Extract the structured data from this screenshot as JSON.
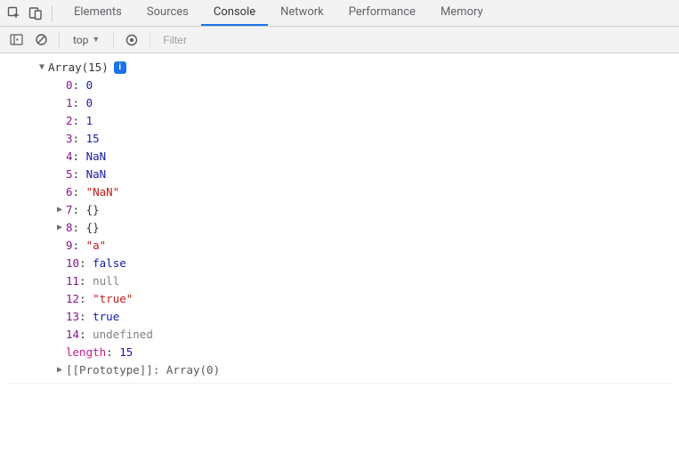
{
  "toolbar": {
    "tabs": [
      "Elements",
      "Sources",
      "Console",
      "Network",
      "Performance",
      "Memory"
    ],
    "active_tab_index": 2
  },
  "consolebar": {
    "context": "top",
    "filter_placeholder": "Filter"
  },
  "output": {
    "header": "Array(15)",
    "info": "i",
    "entries": [
      {
        "index": "0",
        "value": "0",
        "type": "num"
      },
      {
        "index": "1",
        "value": "0",
        "type": "num"
      },
      {
        "index": "2",
        "value": "1",
        "type": "num"
      },
      {
        "index": "3",
        "value": "15",
        "type": "num"
      },
      {
        "index": "4",
        "value": "NaN",
        "type": "nan"
      },
      {
        "index": "5",
        "value": "NaN",
        "type": "nan"
      },
      {
        "index": "6",
        "value": "\"NaN\"",
        "type": "str"
      },
      {
        "index": "7",
        "value": "{}",
        "type": "obj",
        "expandable": true
      },
      {
        "index": "8",
        "value": "{}",
        "type": "obj",
        "expandable": true
      },
      {
        "index": "9",
        "value": "\"a\"",
        "type": "str"
      },
      {
        "index": "10",
        "value": "false",
        "type": "bool"
      },
      {
        "index": "11",
        "value": "null",
        "type": "null"
      },
      {
        "index": "12",
        "value": "\"true\"",
        "type": "str"
      },
      {
        "index": "13",
        "value": "true",
        "type": "bool"
      },
      {
        "index": "14",
        "value": "undefined",
        "type": "undef"
      }
    ],
    "length_key": "length",
    "length_value": "15",
    "proto_key": "[[Prototype]]",
    "proto_value": "Array(0)"
  }
}
